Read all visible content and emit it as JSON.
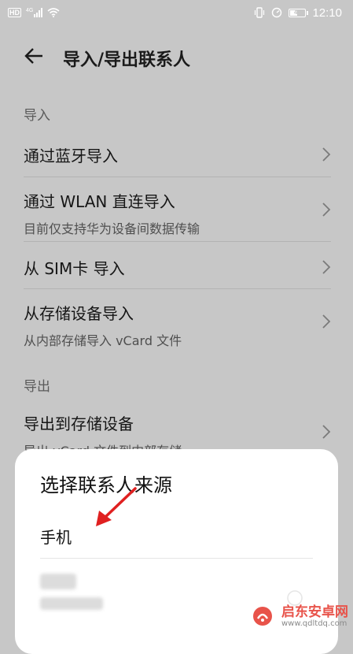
{
  "status_bar": {
    "carrier_badge": "HD",
    "network": "4G",
    "battery_level": 49,
    "battery_text": "49",
    "time": "12:10"
  },
  "app_bar": {
    "title": "导入/导出联系人",
    "back_icon": "arrow-left-icon"
  },
  "import_section": {
    "label": "导入",
    "items": [
      {
        "title": "通过蓝牙导入"
      },
      {
        "title": "通过 WLAN 直连导入",
        "subtitle": "目前仅支持华为设备间数据传输"
      },
      {
        "title": "从 SIM卡 导入"
      },
      {
        "title": "从存储设备导入",
        "subtitle": "从内部存储导入 vCard 文件"
      }
    ]
  },
  "export_section": {
    "label": "导出",
    "items": [
      {
        "title": "导出到存储设备",
        "subtitle": "导出 vCard 文件到内部存储"
      }
    ]
  },
  "source_sheet": {
    "title": "选择联系人来源",
    "options": [
      {
        "label": "手机"
      }
    ]
  },
  "watermark": {
    "name": "启东安卓网",
    "url": "www.qdltdq.com"
  },
  "colors": {
    "dim_background": "#c7c7c7",
    "sheet_background": "#ffffff",
    "annotation_arrow": "#e02020",
    "watermark": "#e8534a"
  }
}
